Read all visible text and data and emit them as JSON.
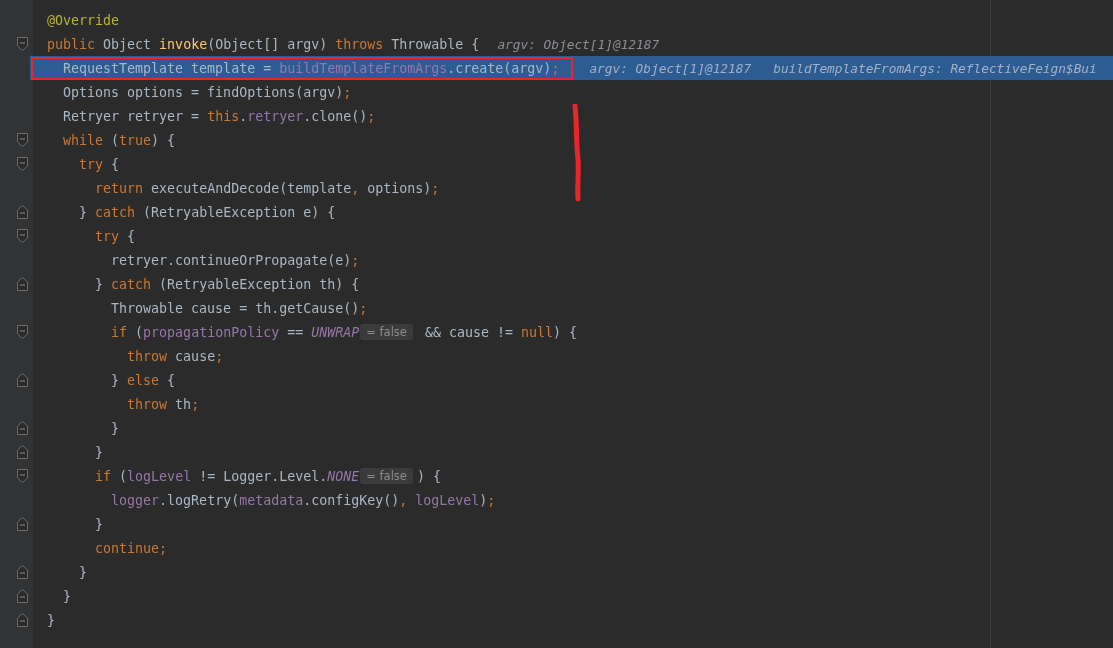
{
  "editor": {
    "lines": [
      {
        "fold_start": false,
        "fold_end": false,
        "current": false,
        "boxed": false,
        "tokens": [
          {
            "kind": "anno",
            "text": "@Override"
          }
        ]
      },
      {
        "fold_start": true,
        "fold_end": false,
        "current": false,
        "boxed": false,
        "tokens": [
          {
            "kind": "kw",
            "text": "public"
          },
          {
            "kind": "plain",
            "text": " Object "
          },
          {
            "kind": "method",
            "text": "invoke"
          },
          {
            "kind": "plain",
            "text": "(Object[] argv) "
          },
          {
            "kind": "kw",
            "text": "throws"
          },
          {
            "kind": "plain",
            "text": " Throwable {"
          },
          {
            "kind": "hint",
            "text": "argv: Object[1]@12187"
          }
        ]
      },
      {
        "fold_start": false,
        "fold_end": false,
        "current": true,
        "boxed": true,
        "tokens": [
          {
            "kind": "plain",
            "text": "  RequestTemplate template = "
          },
          {
            "kind": "field",
            "text": "buildTemplateFromArgs"
          },
          {
            "kind": "plain",
            "text": ".create(argv)"
          },
          {
            "kind": "punct",
            "text": ";"
          },
          {
            "kind": "hint",
            "text": "argv: Object[1]@12187"
          },
          {
            "kind": "hint",
            "text": "buildTemplateFromArgs: ReflectiveFeign$Bui"
          }
        ]
      },
      {
        "fold_start": false,
        "fold_end": false,
        "current": false,
        "boxed": false,
        "tokens": [
          {
            "kind": "plain",
            "text": "  Options options = findOptions(argv)"
          },
          {
            "kind": "punct",
            "text": ";"
          }
        ]
      },
      {
        "fold_start": false,
        "fold_end": false,
        "current": false,
        "boxed": false,
        "tokens": [
          {
            "kind": "plain",
            "text": "  Retryer retryer = "
          },
          {
            "kind": "kw",
            "text": "this"
          },
          {
            "kind": "plain",
            "text": "."
          },
          {
            "kind": "field",
            "text": "retryer"
          },
          {
            "kind": "plain",
            "text": ".clone()"
          },
          {
            "kind": "punct",
            "text": ";"
          }
        ]
      },
      {
        "fold_start": true,
        "fold_end": false,
        "current": false,
        "boxed": false,
        "tokens": [
          {
            "kind": "kw",
            "text": "  while"
          },
          {
            "kind": "plain",
            "text": " ("
          },
          {
            "kind": "kw",
            "text": "true"
          },
          {
            "kind": "plain",
            "text": ") {"
          }
        ]
      },
      {
        "fold_start": true,
        "fold_end": false,
        "current": false,
        "boxed": false,
        "tokens": [
          {
            "kind": "kw",
            "text": "    try"
          },
          {
            "kind": "plain",
            "text": " {"
          }
        ]
      },
      {
        "fold_start": false,
        "fold_end": false,
        "current": false,
        "boxed": false,
        "tokens": [
          {
            "kind": "kw",
            "text": "      return"
          },
          {
            "kind": "plain",
            "text": " executeAndDecode(template"
          },
          {
            "kind": "punct",
            "text": ","
          },
          {
            "kind": "plain",
            "text": " options)"
          },
          {
            "kind": "punct",
            "text": ";"
          }
        ]
      },
      {
        "fold_start": false,
        "fold_end": true,
        "current": false,
        "boxed": false,
        "tokens": [
          {
            "kind": "plain",
            "text": "    } "
          },
          {
            "kind": "kw",
            "text": "catch"
          },
          {
            "kind": "plain",
            "text": " (RetryableException e) {"
          }
        ]
      },
      {
        "fold_start": true,
        "fold_end": false,
        "current": false,
        "boxed": false,
        "tokens": [
          {
            "kind": "kw",
            "text": "      try"
          },
          {
            "kind": "plain",
            "text": " {"
          }
        ]
      },
      {
        "fold_start": false,
        "fold_end": false,
        "current": false,
        "boxed": false,
        "tokens": [
          {
            "kind": "plain",
            "text": "        retryer.continueOrPropagate(e)"
          },
          {
            "kind": "punct",
            "text": ";"
          }
        ]
      },
      {
        "fold_start": false,
        "fold_end": true,
        "current": false,
        "boxed": false,
        "tokens": [
          {
            "kind": "plain",
            "text": "      } "
          },
          {
            "kind": "kw",
            "text": "catch"
          },
          {
            "kind": "plain",
            "text": " (RetryableException th) {"
          }
        ]
      },
      {
        "fold_start": false,
        "fold_end": false,
        "current": false,
        "boxed": false,
        "tokens": [
          {
            "kind": "plain",
            "text": "        Throwable cause = th.getCause()"
          },
          {
            "kind": "punct",
            "text": ";"
          }
        ]
      },
      {
        "fold_start": true,
        "fold_end": false,
        "current": false,
        "boxed": false,
        "tokens": [
          {
            "kind": "kw",
            "text": "        if"
          },
          {
            "kind": "plain",
            "text": " ("
          },
          {
            "kind": "field",
            "text": "propagationPolicy"
          },
          {
            "kind": "plain",
            "text": " == "
          },
          {
            "kind": "const",
            "text": "UNWRAP"
          },
          {
            "kind": "inlay",
            "text": "= false"
          },
          {
            "kind": "plain",
            "text": " && cause != "
          },
          {
            "kind": "kw",
            "text": "null"
          },
          {
            "kind": "plain",
            "text": ") {"
          }
        ]
      },
      {
        "fold_start": false,
        "fold_end": false,
        "current": false,
        "boxed": false,
        "tokens": [
          {
            "kind": "kw",
            "text": "          throw"
          },
          {
            "kind": "plain",
            "text": " cause"
          },
          {
            "kind": "punct",
            "text": ";"
          }
        ]
      },
      {
        "fold_start": false,
        "fold_end": true,
        "current": false,
        "boxed": false,
        "tokens": [
          {
            "kind": "plain",
            "text": "        } "
          },
          {
            "kind": "kw",
            "text": "else"
          },
          {
            "kind": "plain",
            "text": " {"
          }
        ]
      },
      {
        "fold_start": false,
        "fold_end": false,
        "current": false,
        "boxed": false,
        "tokens": [
          {
            "kind": "kw",
            "text": "          throw"
          },
          {
            "kind": "plain",
            "text": " th"
          },
          {
            "kind": "punct",
            "text": ";"
          }
        ]
      },
      {
        "fold_start": false,
        "fold_end": true,
        "current": false,
        "boxed": false,
        "tokens": [
          {
            "kind": "plain",
            "text": "        }"
          }
        ]
      },
      {
        "fold_start": false,
        "fold_end": true,
        "current": false,
        "boxed": false,
        "tokens": [
          {
            "kind": "plain",
            "text": "      }"
          }
        ]
      },
      {
        "fold_start": true,
        "fold_end": false,
        "current": false,
        "boxed": false,
        "tokens": [
          {
            "kind": "kw",
            "text": "      if"
          },
          {
            "kind": "plain",
            "text": " ("
          },
          {
            "kind": "field",
            "text": "logLevel"
          },
          {
            "kind": "plain",
            "text": " != Logger.Level."
          },
          {
            "kind": "const",
            "text": "NONE"
          },
          {
            "kind": "inlay",
            "text": "= false"
          },
          {
            "kind": "plain",
            "text": ") {"
          }
        ]
      },
      {
        "fold_start": false,
        "fold_end": false,
        "current": false,
        "boxed": false,
        "tokens": [
          {
            "kind": "field",
            "text": "        logger"
          },
          {
            "kind": "plain",
            "text": ".logRetry("
          },
          {
            "kind": "field",
            "text": "metadata"
          },
          {
            "kind": "plain",
            "text": ".configKey()"
          },
          {
            "kind": "punct",
            "text": ", "
          },
          {
            "kind": "field",
            "text": "logLevel"
          },
          {
            "kind": "plain",
            "text": ")"
          },
          {
            "kind": "punct",
            "text": ";"
          }
        ]
      },
      {
        "fold_start": false,
        "fold_end": true,
        "current": false,
        "boxed": false,
        "tokens": [
          {
            "kind": "plain",
            "text": "      }"
          }
        ]
      },
      {
        "fold_start": false,
        "fold_end": false,
        "current": false,
        "boxed": false,
        "tokens": [
          {
            "kind": "kw",
            "text": "      continue"
          },
          {
            "kind": "punct",
            "text": ";"
          }
        ]
      },
      {
        "fold_start": false,
        "fold_end": true,
        "current": false,
        "boxed": false,
        "tokens": [
          {
            "kind": "plain",
            "text": "    }"
          }
        ]
      },
      {
        "fold_start": false,
        "fold_end": true,
        "current": false,
        "boxed": false,
        "tokens": [
          {
            "kind": "plain",
            "text": "  }"
          }
        ]
      },
      {
        "fold_start": false,
        "fold_end": true,
        "current": false,
        "boxed": false,
        "tokens": [
          {
            "kind": "plain",
            "text": "}"
          }
        ]
      }
    ]
  }
}
